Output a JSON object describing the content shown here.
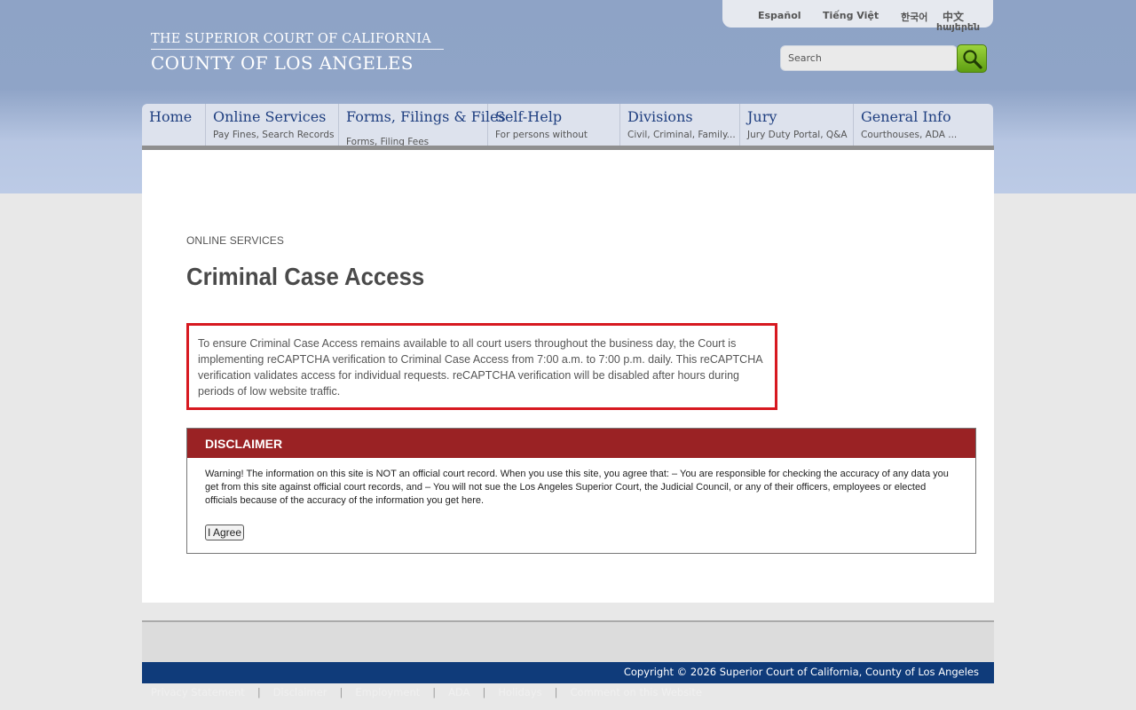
{
  "header": {
    "logo_line1": "THE SUPERIOR COURT OF CALIFORNIA",
    "logo_line2": "COUNTY OF LOS ANGELES",
    "languages": [
      "Español",
      "Tiếng Việt",
      "한국어",
      "中文",
      "հայերեն"
    ],
    "search": {
      "placeholder": "Search"
    }
  },
  "nav": [
    {
      "title": "Home",
      "sub": ""
    },
    {
      "title": "Online Services",
      "sub": "Pay Fines, Search Records"
    },
    {
      "title": "Forms, Filings & Files",
      "sub": "Forms, Filing Fees"
    },
    {
      "title": "Self-Help",
      "sub": "For persons without attorneys"
    },
    {
      "title": "Divisions",
      "sub": "Civil, Criminal, Family..."
    },
    {
      "title": "Jury",
      "sub": "Jury Duty Portal, Q&A"
    },
    {
      "title": "General Info",
      "sub": "Courthouses, ADA ..."
    }
  ],
  "main": {
    "breadcrumb": "ONLINE SERVICES",
    "title": "Criminal Case Access",
    "notice": "To ensure Criminal Case Access remains available to all court users throughout the business day, the Court is implementing reCAPTCHA verification to Criminal Case Access from 7:00 a.m. to 7:00 p.m. daily. This reCAPTCHA verification validates access for individual requests. reCAPTCHA verification will be disabled after hours during periods of low website traffic.",
    "disclaimer": {
      "heading": "DISCLAIMER",
      "text": "Warning! The information on this site is NOT an official court record. When you use this site, you agree that: – You are responsible for checking the accuracy of any data you get from this site against official court records, and – You will not sue the Los Angeles Superior Court, the Judicial Council, or any of their officers, employees or elected officials because of the accuracy of the information you get here.",
      "agree_label": "I Agree"
    }
  },
  "footer": {
    "copyright": "Copyright © 2026 Superior Court of California, County of Los Angeles",
    "links": [
      "Privacy Statement",
      "Disclaimer",
      "Employment",
      "ADA",
      "Holidays",
      "Comment on this Website"
    ]
  },
  "colors": {
    "header_blue": "#8ea3c6",
    "nav_title": "#1f3f80",
    "notice_border": "#d71920",
    "disclaimer_header": "#9a2224",
    "footer_blue": "#0f3b7a",
    "search_green": "#7dbb26"
  }
}
